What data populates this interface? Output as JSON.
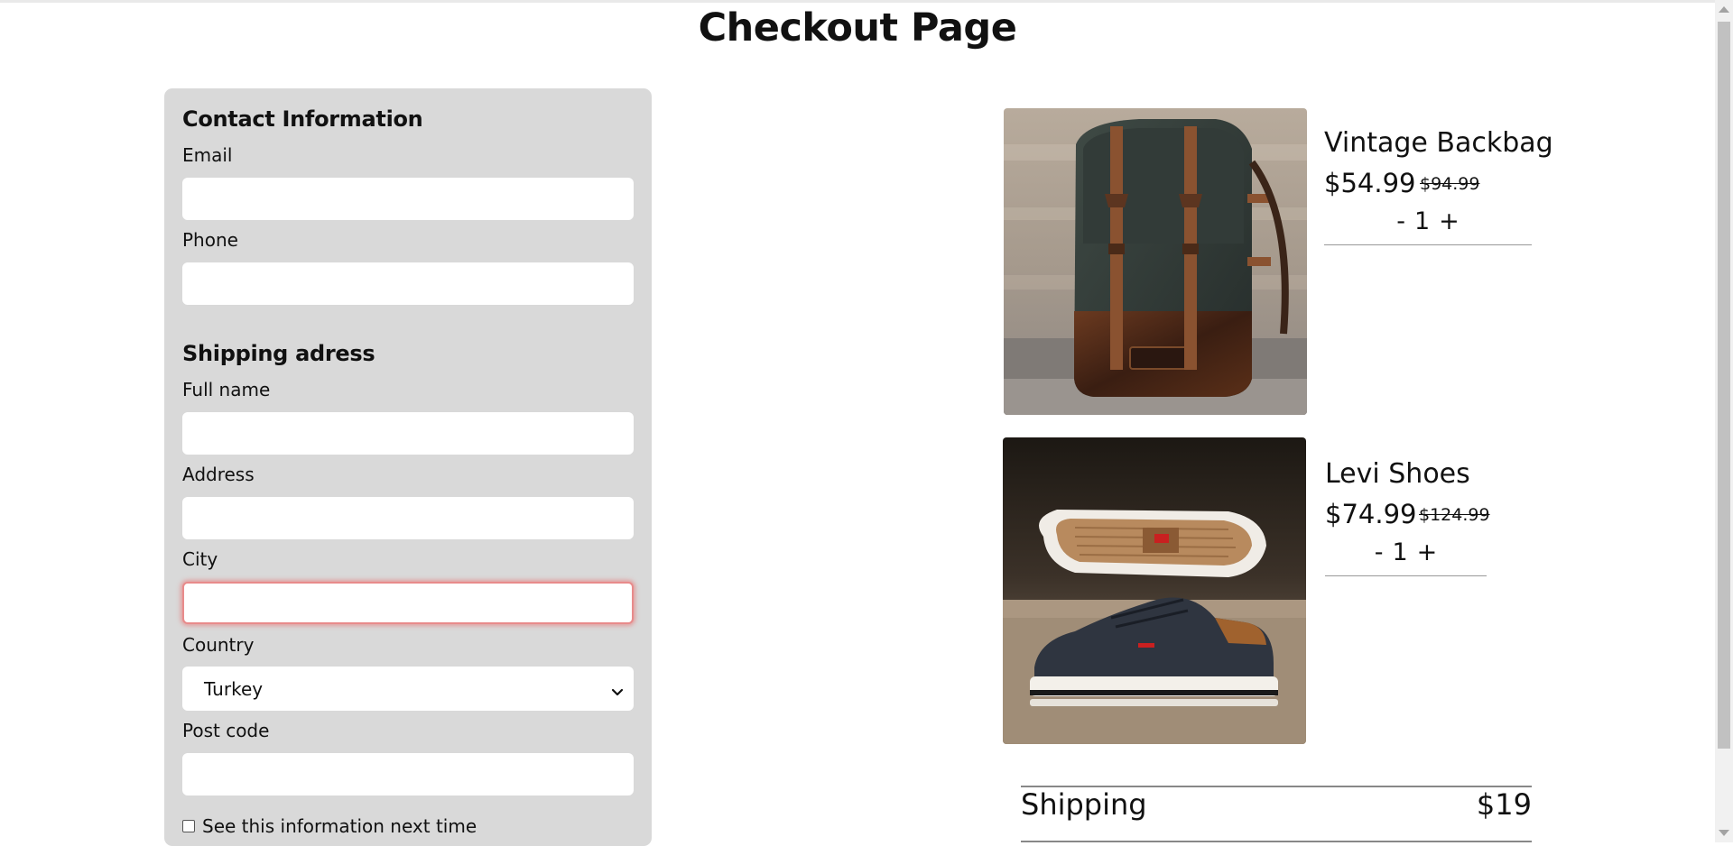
{
  "page": {
    "title": "Checkout Page"
  },
  "contact": {
    "heading": "Contact Information",
    "email_label": "Email",
    "email_value": "",
    "phone_label": "Phone",
    "phone_value": ""
  },
  "shipping_address": {
    "heading": "Shipping adress",
    "fullname_label": "Full name",
    "fullname_value": "",
    "address_label": "Address",
    "address_value": "",
    "city_label": "City",
    "city_value": "",
    "city_state": "error",
    "country_label": "Country",
    "country_selected": "Turkey",
    "postcode_label": "Post code",
    "postcode_value": "",
    "remember_label": "See this information next time",
    "remember_checked": false
  },
  "cart": {
    "items": [
      {
        "name": "Vintage Backbag",
        "price": "$54.99",
        "old_price": "$94.99",
        "qty_minus": "-",
        "qty": "1",
        "qty_plus": "+",
        "image": "backpack-photo"
      },
      {
        "name": "Levi Shoes",
        "price": "$74.99",
        "old_price": "$124.99",
        "qty_minus": "-",
        "qty": "1",
        "qty_plus": "+",
        "image": "sneaker-photo"
      }
    ],
    "shipping_label": "Shipping",
    "shipping_value": "$19"
  },
  "colors": {
    "panel_bg": "#d9d9d9",
    "error_glow": "#e88b8b"
  }
}
